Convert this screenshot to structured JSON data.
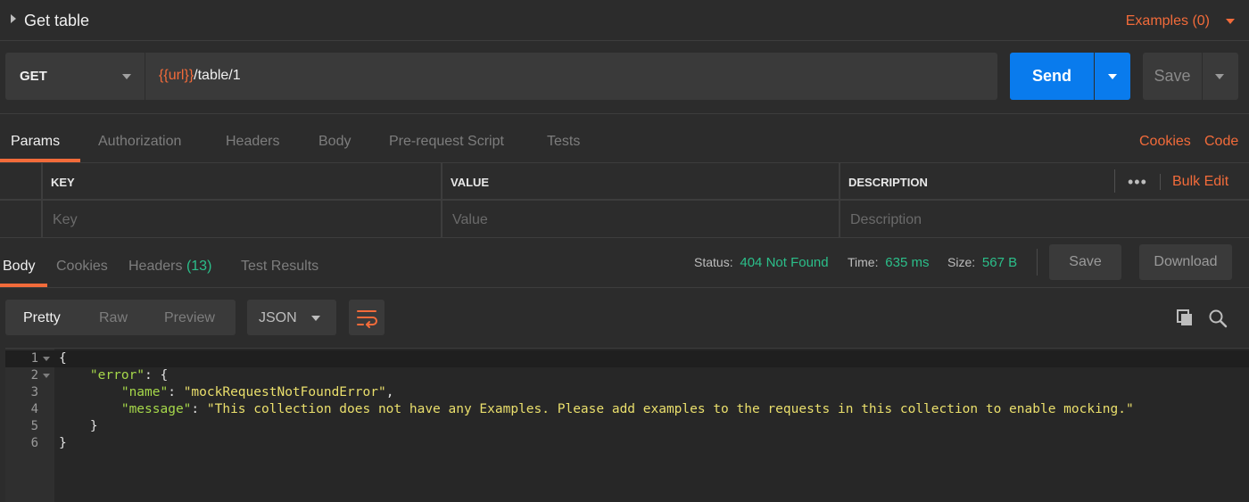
{
  "request": {
    "name": "Get table",
    "examples_label": "Examples (0)",
    "method": "GET",
    "url_var": "{{url}}",
    "url_path": "/table/1",
    "send_label": "Send",
    "save_label": "Save"
  },
  "request_tabs": [
    "Params",
    "Authorization",
    "Headers",
    "Body",
    "Pre-request Script",
    "Tests"
  ],
  "request_links": {
    "cookies": "Cookies",
    "code": "Code"
  },
  "params": {
    "headers": [
      "KEY",
      "VALUE",
      "DESCRIPTION"
    ],
    "placeholders": [
      "Key",
      "Value",
      "Description"
    ],
    "more": "•••",
    "bulk_edit": "Bulk Edit"
  },
  "response": {
    "tabs": {
      "body": "Body",
      "cookies": "Cookies",
      "headers": "Headers",
      "headers_count": "(13)",
      "tests": "Test Results"
    },
    "status_label": "Status:",
    "status_value": "404 Not Found",
    "time_label": "Time:",
    "time_value": "635 ms",
    "size_label": "Size:",
    "size_value": "567 B",
    "save_label": "Save",
    "download_label": "Download"
  },
  "body_view": {
    "modes": [
      "Pretty",
      "Raw",
      "Preview"
    ],
    "format": "JSON"
  },
  "code": {
    "line_numbers": [
      "1",
      "2",
      "3",
      "4",
      "5",
      "6"
    ],
    "l1": "{",
    "l2_key": "\"error\"",
    "l2_rest": ": {",
    "l3_key": "\"name\"",
    "l3_sep": ": ",
    "l3_val": "\"mockRequestNotFoundError\"",
    "l3_end": ",",
    "l4_key": "\"message\"",
    "l4_sep": ": ",
    "l4_val": "\"This collection does not have any Examples. Please add examples to the requests in this collection to enable mocking.\"",
    "l5": "}",
    "l6": "}"
  },
  "colors": {
    "accent": "#f26b3a",
    "send": "#097bed",
    "success": "#2bbf8a",
    "json_key": "#a6d84a",
    "json_string": "#eadf6c"
  }
}
